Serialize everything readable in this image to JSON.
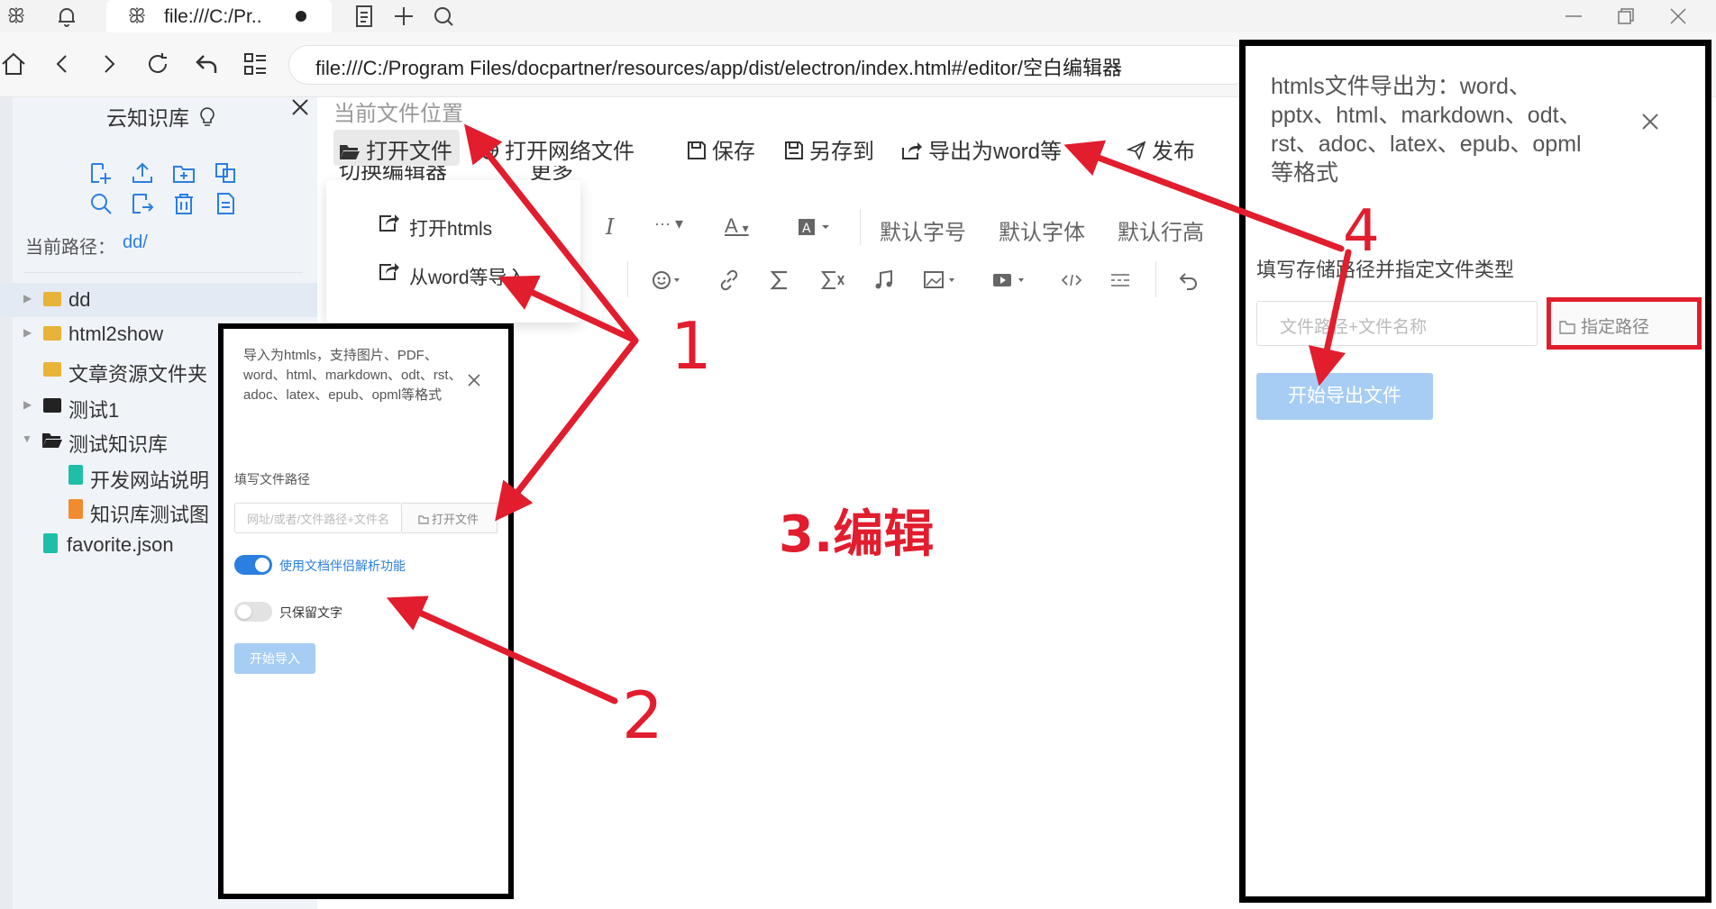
{
  "browser": {
    "tab_title": "file:///C:/Pr..",
    "url": "file:///C:/Program Files/docpartner/resources/app/dist/electron/index.html#/editor/空白编辑器"
  },
  "sidebar": {
    "title": "云知识库",
    "current_path_label": "当前路径：",
    "current_path_value": "dd/",
    "tree": [
      {
        "label": "dd",
        "type": "folder",
        "color": "#e8b339"
      },
      {
        "label": "html2show",
        "type": "folder",
        "color": "#e8b339"
      },
      {
        "label": "文章资源文件夹",
        "type": "folder",
        "color": "#e8b339"
      },
      {
        "label": "测试1",
        "type": "folder",
        "color": "#222222"
      },
      {
        "label": "测试知识库",
        "type": "folder-open",
        "color": "#222222"
      },
      {
        "label": "开发网站说明",
        "type": "file",
        "color": "#1fbfa7"
      },
      {
        "label": "知识库测试图",
        "type": "file",
        "color": "#f08c2e"
      },
      {
        "label": "favorite.json",
        "type": "file",
        "color": "#1fbfa7"
      }
    ]
  },
  "editor": {
    "current_file_label": "当前文件位置",
    "toolbar": {
      "open_file": "打开文件",
      "open_web_file": "打开网络文件",
      "save": "保存",
      "save_as": "另存到",
      "export_word": "导出为word等",
      "publish": "发布",
      "switch_editor": "切换编辑器",
      "more": "更多"
    },
    "open_menu": {
      "open_htmls": "打开htmls",
      "import_word": "从word等导入"
    },
    "format": {
      "default_size": "默认字号",
      "default_font": "默认字体",
      "default_line_height": "默认行高"
    }
  },
  "import_dialog": {
    "description": "导入为htmls，支持图片、PDF、word、html、markdown、odt、rst、adoc、latex、epub、opml等格式",
    "path_label": "填写文件路径",
    "path_placeholder": "网址/或者/文件路径+文件名",
    "open_file_button": "打开文件",
    "toggle_parse_label": "使用文档伴侣解析功能",
    "toggle_parse_on": true,
    "toggle_text_only_label": "只保留文字",
    "toggle_text_only_on": false,
    "start_button": "开始导入"
  },
  "export_dialog": {
    "description": "htmls文件导出为：word、pptx、html、markdown、odt、rst、adoc、latex、epub、opml等格式",
    "path_label": "填写存储路径并指定文件类型",
    "path_placeholder": "文件路径+文件名称",
    "set_path_button": "指定路径",
    "start_button": "开始导出文件"
  },
  "annotations": {
    "step1": "1",
    "step2": "2",
    "step3": "3.编辑",
    "step4": "4",
    "color": "#e11d2e"
  }
}
